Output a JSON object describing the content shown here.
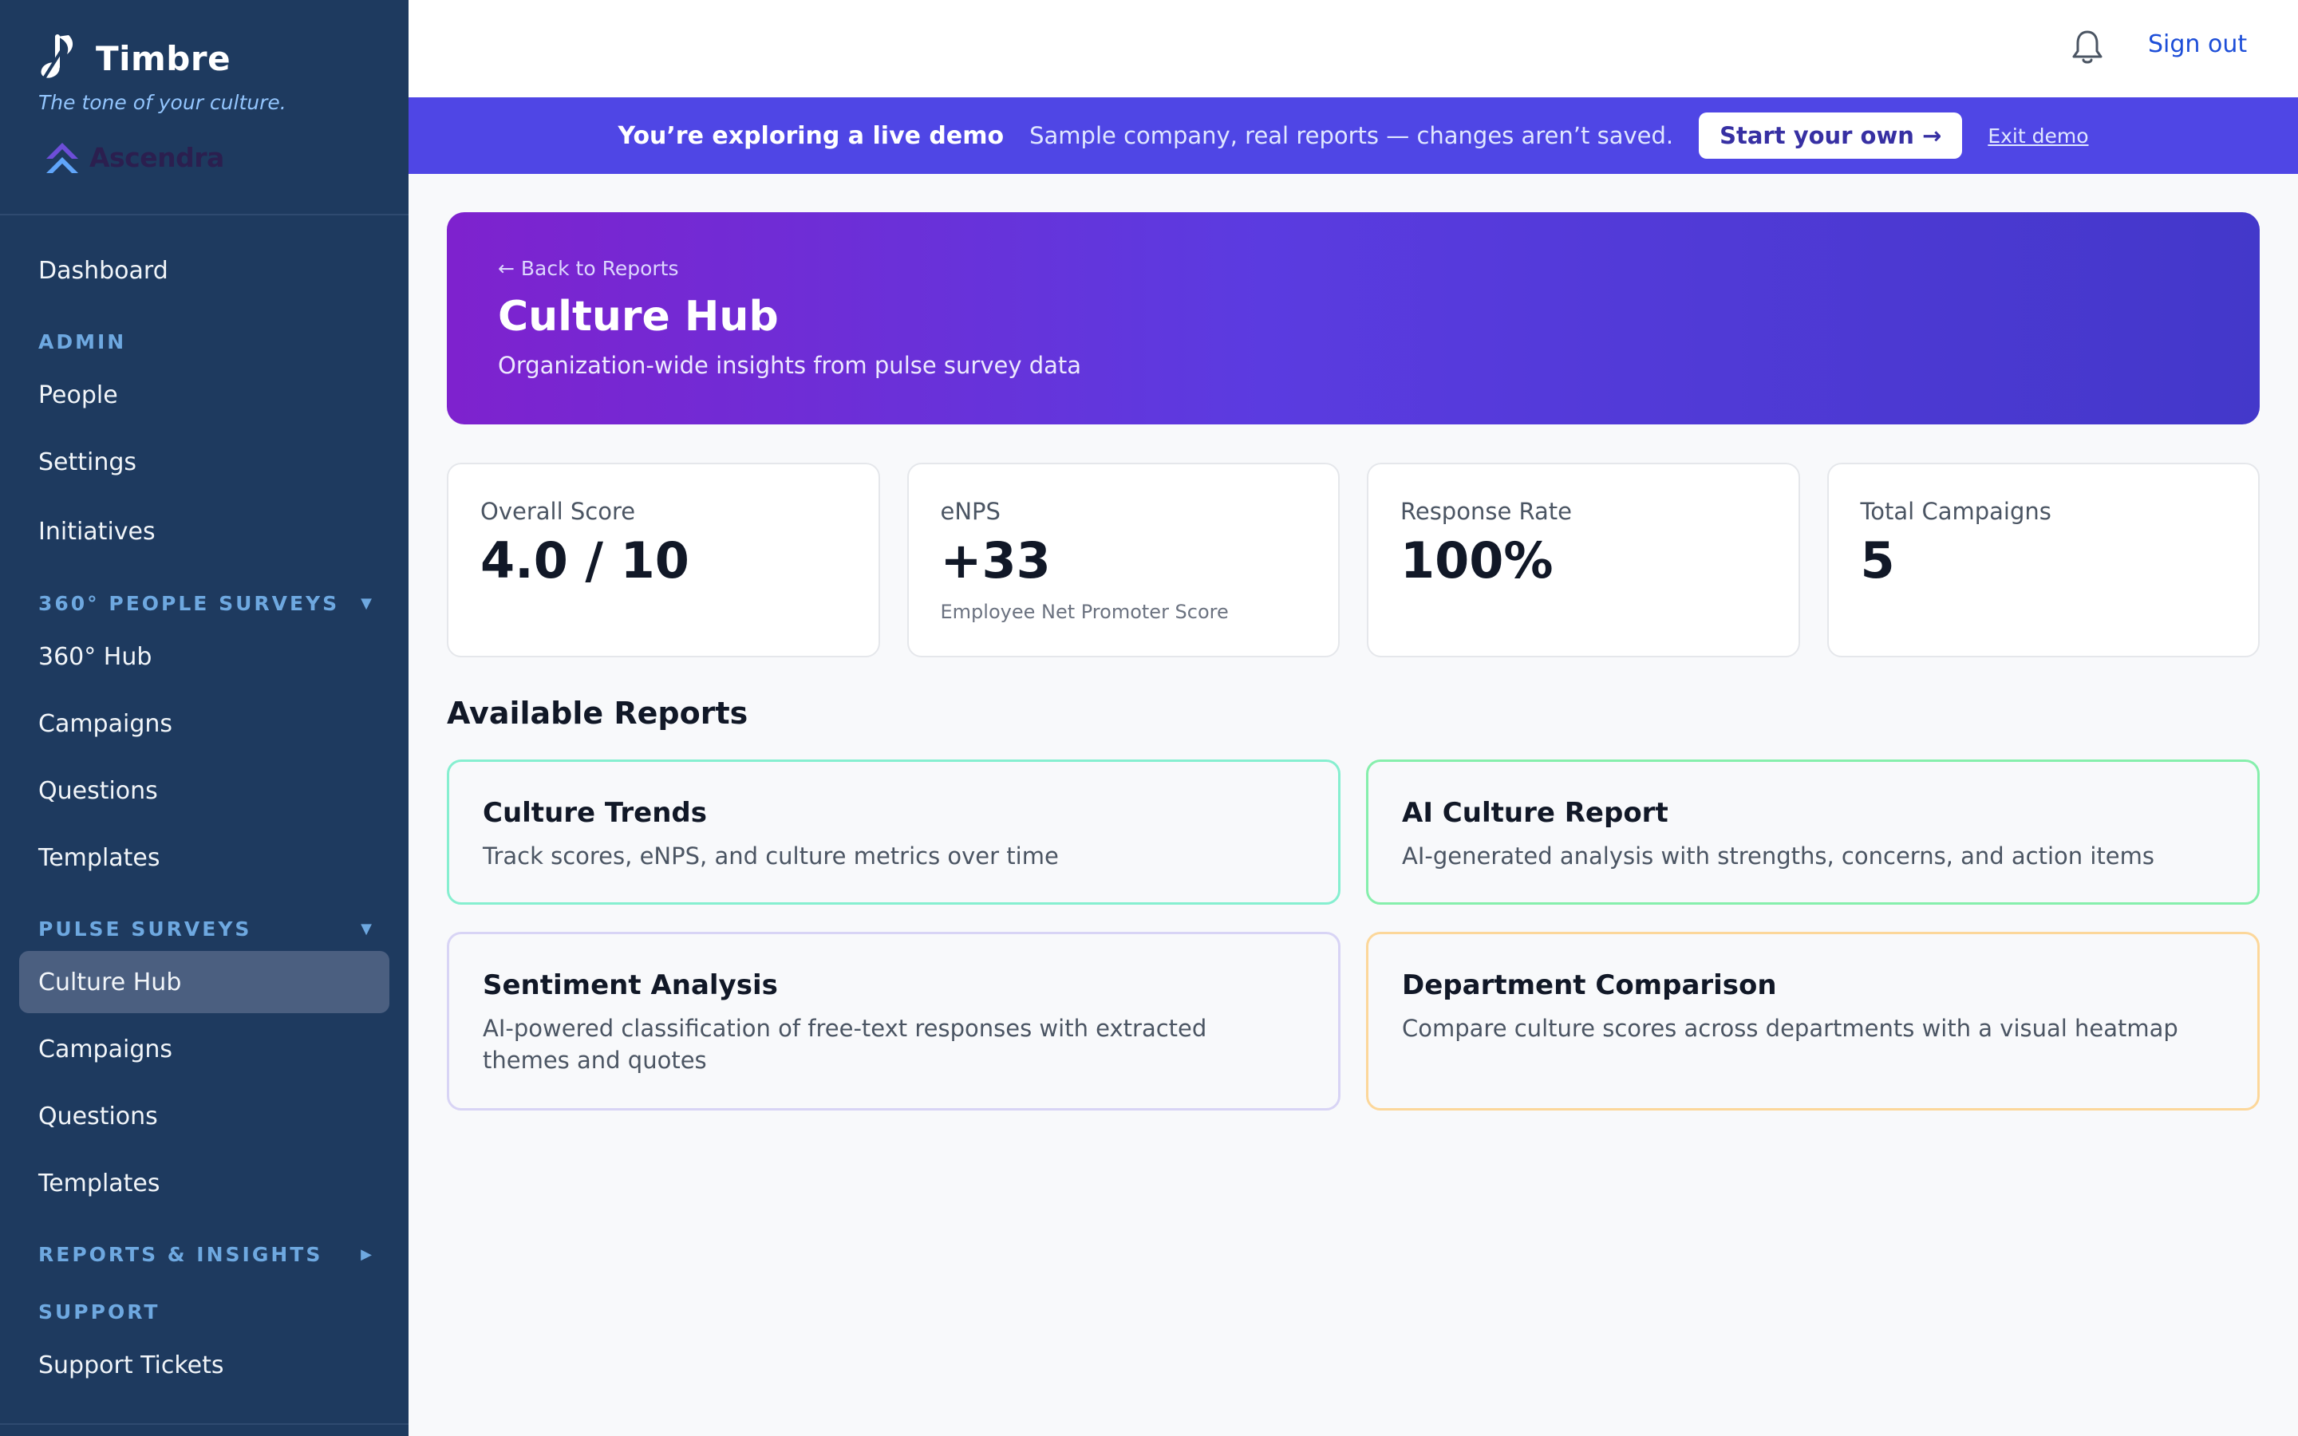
{
  "sidebar": {
    "brand_name": "Timbre",
    "tagline": "The tone of your culture.",
    "org_name": "Ascendra",
    "dashboard": "Dashboard",
    "admin_section": "ADMIN",
    "admin_items": [
      "People",
      "Settings",
      "Initiatives"
    ],
    "people_surveys_section": "360° PEOPLE SURVEYS",
    "people_surveys_items": [
      "360° Hub",
      "Campaigns",
      "Questions",
      "Templates"
    ],
    "pulse_section": "PULSE SURVEYS",
    "pulse_items": [
      "Culture Hub",
      "Campaigns",
      "Questions",
      "Templates"
    ],
    "active_item": "Culture Hub",
    "reports_section": "REPORTS & INSIGHTS",
    "support_section": "SUPPORT",
    "support_items": [
      "Support Tickets"
    ],
    "caret_expanded": "▼",
    "caret_collapsed": "▶"
  },
  "topbar": {
    "icon": "bell-icon",
    "signout": "Sign out"
  },
  "demo_banner": {
    "title": "You’re exploring a live demo",
    "text": "Sample company, real reports — changes aren’t saved.",
    "button": "Start your own →",
    "exit": "Exit demo"
  },
  "hero": {
    "back": "← Back to Reports",
    "title": "Culture Hub",
    "subtitle": "Organization-wide insights from pulse survey data"
  },
  "stats": [
    {
      "label": "Overall Score",
      "value": "4.0 / 10",
      "note": ""
    },
    {
      "label": "eNPS",
      "value": "+33",
      "note": "Employee Net Promoter Score"
    },
    {
      "label": "Response Rate",
      "value": "100%",
      "note": ""
    },
    {
      "label": "Total Campaigns",
      "value": "5",
      "note": ""
    }
  ],
  "reports": {
    "heading": "Available Reports",
    "items": [
      {
        "title": "Culture Trends",
        "desc": "Track scores, eNPS, and culture metrics over time",
        "border": "#86efd0"
      },
      {
        "title": "AI Culture Report",
        "desc": "AI-generated analysis with strengths, concerns, and action items",
        "border": "#86efac"
      },
      {
        "title": "Sentiment Analysis",
        "desc": "AI-powered classification of free-text responses with extracted themes and quotes",
        "border": "#d8d4f5"
      },
      {
        "title": "Department Comparison",
        "desc": "Compare culture scores across departments with a visual heatmap",
        "border": "#fcd79a"
      }
    ]
  },
  "colors": {
    "sidebar_bg": "#1e3a5f",
    "demo_banner_bg": "#4f46e5",
    "hero_gradient_start": "#7e22ce",
    "hero_gradient_end": "#4338ca",
    "link": "#1d4ed8"
  }
}
